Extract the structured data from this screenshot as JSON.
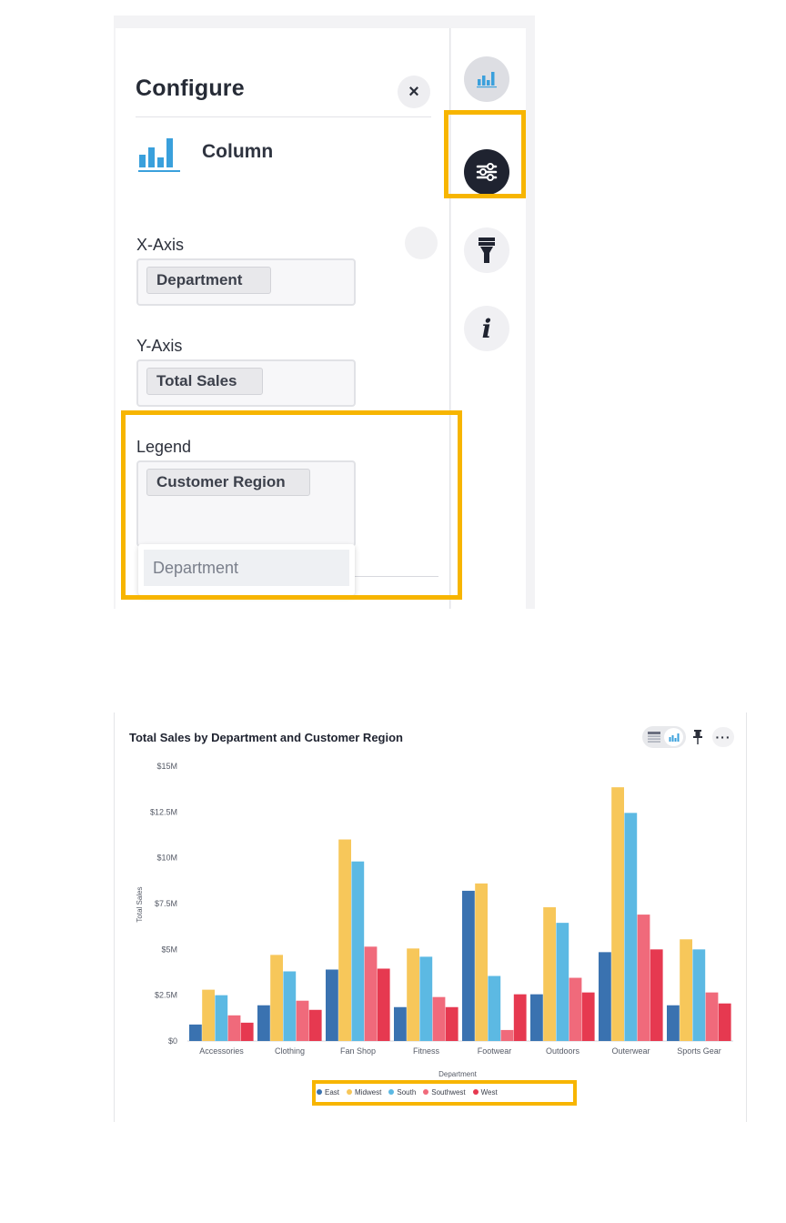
{
  "config_panel": {
    "title": "Configure",
    "close_label": "×",
    "chart_type": "Column",
    "fields": {
      "x_axis": {
        "label": "X-Axis",
        "chip": "Department"
      },
      "y_axis": {
        "label": "Y-Axis",
        "chip": "Total Sales"
      },
      "legend": {
        "label": "Legend",
        "chip": "Customer Region"
      }
    },
    "dropdown_option": "Department"
  },
  "side_rail": {
    "items": [
      "chart-icon",
      "settings-sliders-icon",
      "brush-icon",
      "info-icon"
    ],
    "info_glyph": "i",
    "active": "settings-sliders-icon"
  },
  "colors": {
    "highlight": "#f7b500",
    "accent_blue": "#3aa0dc",
    "dark": "#1f2330"
  },
  "chart_card": {
    "title": "Total Sales by Department and Customer Region",
    "more_label": "···",
    "toolbar_icons": [
      "table-icon",
      "column-chart-icon",
      "pin-icon",
      "more-icon"
    ]
  },
  "chart_data": {
    "type": "bar",
    "title": "Total Sales by Department and Customer Region",
    "xlabel": "Department",
    "ylabel": "Total Sales",
    "ylim": [
      0,
      15000000
    ],
    "yticks": [
      "$0",
      "$2.5M",
      "$5M",
      "$7.5M",
      "$10M",
      "$12.5M",
      "$15M"
    ],
    "legend_position": "bottom",
    "categories": [
      "Accessories",
      "Clothing",
      "Fan Shop",
      "Fitness",
      "Footwear",
      "Outdoors",
      "Outerwear",
      "Sports Gear"
    ],
    "series": [
      {
        "name": "East",
        "color": "#3a72b0",
        "values": [
          900000,
          1950000,
          3900000,
          1850000,
          8200000,
          2550000,
          4850000,
          1950000
        ]
      },
      {
        "name": "Midwest",
        "color": "#f7c75a",
        "values": [
          2800000,
          4700000,
          11000000,
          5050000,
          8600000,
          7300000,
          13850000,
          5550000
        ]
      },
      {
        "name": "South",
        "color": "#5cb9e3",
        "values": [
          2500000,
          3800000,
          9800000,
          4600000,
          3550000,
          6450000,
          12450000,
          5000000
        ]
      },
      {
        "name": "Southwest",
        "color": "#f06a7b",
        "values": [
          1400000,
          2200000,
          5150000,
          2400000,
          600000,
          3450000,
          6900000,
          2650000
        ]
      },
      {
        "name": "West",
        "color": "#e63950",
        "values": [
          1000000,
          1700000,
          3950000,
          1850000,
          2550000,
          2650000,
          5000000,
          2050000
        ]
      }
    ]
  }
}
